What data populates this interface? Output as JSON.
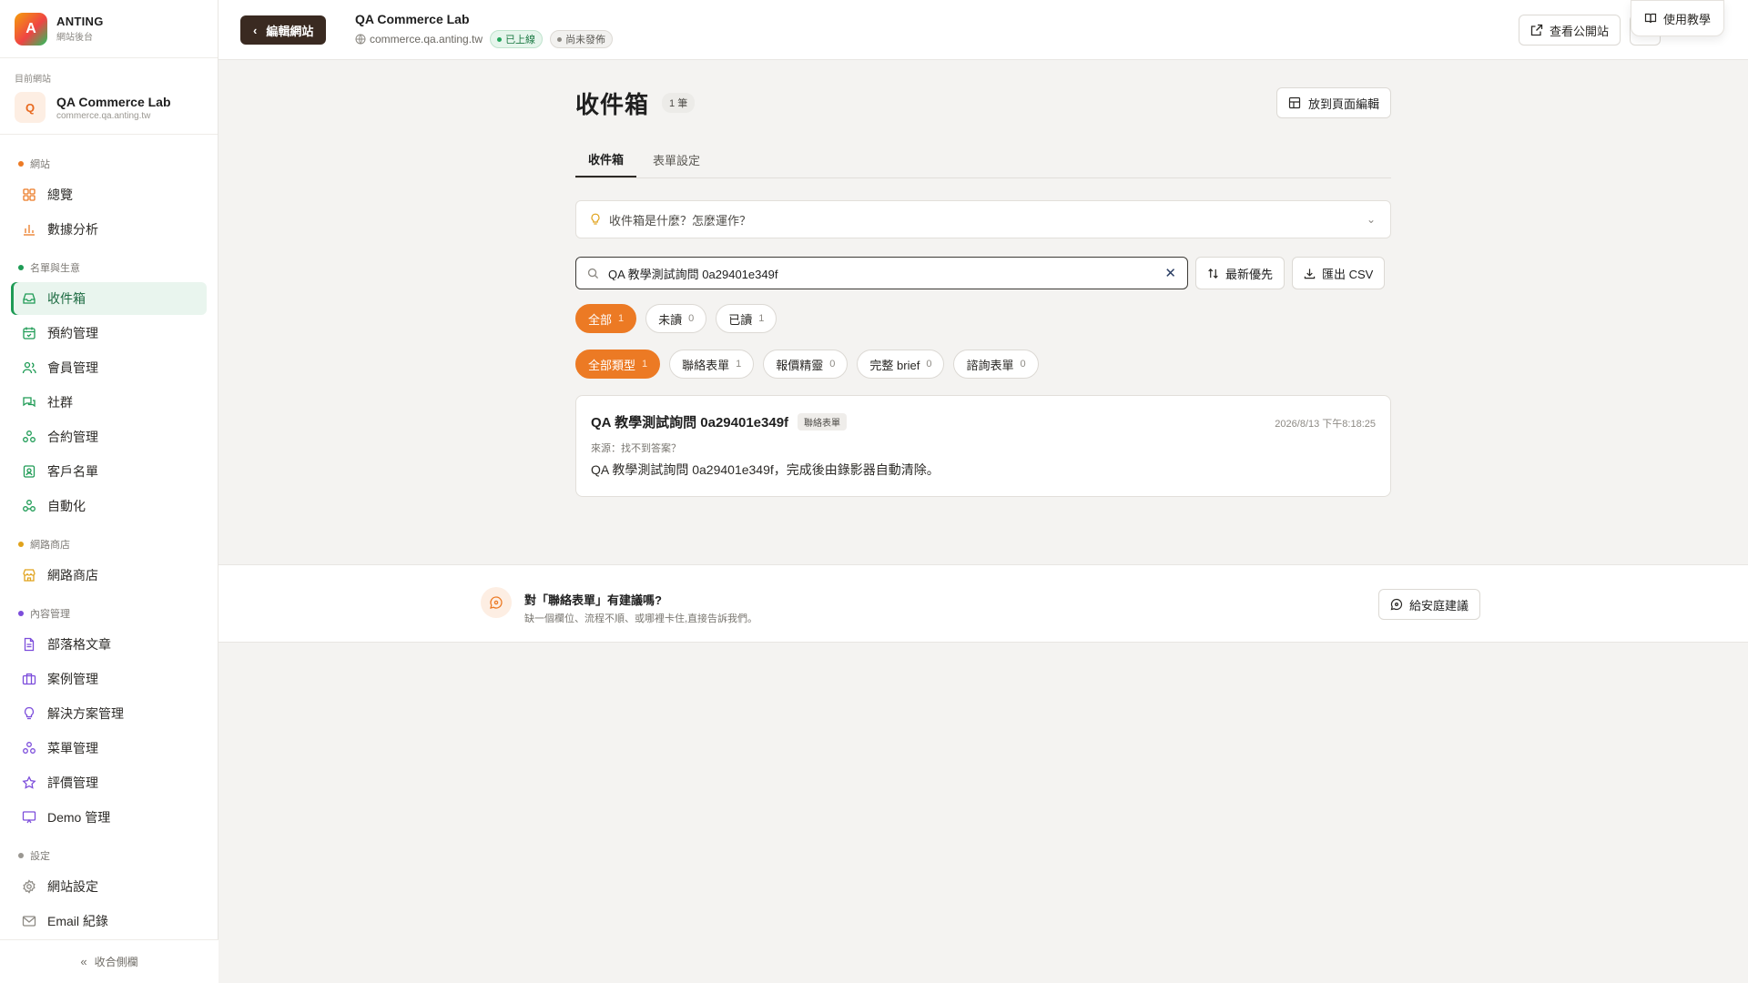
{
  "brand": {
    "logo_letter": "A",
    "name": "ANTING",
    "sub": "網站後台"
  },
  "current_site": {
    "label": "目前網站",
    "avatar": "Q",
    "name": "QA Commerce Lab",
    "domain": "commerce.qa.anting.tw"
  },
  "nav": {
    "groups": [
      {
        "label": "網站",
        "color": "#ec7a24",
        "items": [
          {
            "label": "總覽",
            "icon": "grid-icon"
          },
          {
            "label": "數據分析",
            "icon": "bar-chart-icon"
          }
        ]
      },
      {
        "label": "名單與生意",
        "color": "#1e9b55",
        "items": [
          {
            "label": "收件箱",
            "icon": "inbox-icon",
            "active": true
          },
          {
            "label": "預約管理",
            "icon": "calendar-icon"
          },
          {
            "label": "會員管理",
            "icon": "users-icon"
          },
          {
            "label": "社群",
            "icon": "chat-icon"
          },
          {
            "label": "合約管理",
            "icon": "nodes-icon"
          },
          {
            "label": "客戶名單",
            "icon": "contact-icon"
          },
          {
            "label": "自動化",
            "icon": "automation-icon"
          }
        ]
      },
      {
        "label": "網路商店",
        "color": "#e0a21b",
        "items": [
          {
            "label": "網路商店",
            "icon": "store-icon"
          }
        ]
      },
      {
        "label": "內容管理",
        "color": "#7c4ddb",
        "items": [
          {
            "label": "部落格文章",
            "icon": "document-icon"
          },
          {
            "label": "案例管理",
            "icon": "briefcase-icon"
          },
          {
            "label": "解決方案管理",
            "icon": "lightbulb-icon"
          },
          {
            "label": "菜單管理",
            "icon": "menu-nodes-icon"
          },
          {
            "label": "評價管理",
            "icon": "star-icon"
          },
          {
            "label": "Demo 管理",
            "icon": "presentation-icon"
          }
        ]
      },
      {
        "label": "設定",
        "color": "#9a9791",
        "items": [
          {
            "label": "網站設定",
            "icon": "gear-icon"
          },
          {
            "label": "Email 紀錄",
            "icon": "mail-icon"
          }
        ]
      }
    ],
    "collapse_label": "收合側欄"
  },
  "topbar": {
    "edit_label": "編輯網站",
    "site_title": "QA Commerce Lab",
    "site_domain": "commerce.qa.anting.tw",
    "status_live": "已上線",
    "status_draft": "尚未發佈",
    "view_site_label": "查看公開站",
    "tutorial_label": "使用教學"
  },
  "page": {
    "title": "收件箱",
    "count_badge": "1 筆",
    "place_button": "放到頁面編輯",
    "tabs": [
      {
        "label": "收件箱",
        "active": true
      },
      {
        "label": "表單設定",
        "active": false
      }
    ],
    "accordion_label": "收件箱是什麼？怎麼運作？",
    "search_value": "QA 教學測試詢問 0a29401e349f",
    "sort_label": "最新優先",
    "csv_label": "匯出 CSV",
    "status_chips": [
      {
        "label": "全部",
        "count": "1",
        "active": true
      },
      {
        "label": "未讀",
        "count": "0"
      },
      {
        "label": "已讀",
        "count": "1"
      }
    ],
    "type_chips": [
      {
        "label": "全部類型",
        "count": "1",
        "active": true
      },
      {
        "label": "聯絡表單",
        "count": "1"
      },
      {
        "label": "報價精靈",
        "count": "0"
      },
      {
        "label": "完整 brief",
        "count": "0"
      },
      {
        "label": "諮詢表單",
        "count": "0"
      }
    ],
    "message": {
      "title": "QA 教學測試詢問 0a29401e349f",
      "tag": "聯絡表單",
      "time": "2026/8/13 下午8:18:25",
      "source": "來源：找不到答案？",
      "body": "QA 教學測試詢問 0a29401e349f，完成後由錄影器自動清除。"
    }
  },
  "feedback": {
    "title": "對「聯絡表單」有建議嗎?",
    "sub": "缺一個欄位、流程不順、或哪裡卡住,直接告訴我們。",
    "button": "給安庭建議"
  },
  "colors": {
    "accent": "#ec7a24",
    "active_nav": "#1e9b55",
    "edit_button": "#3a2a21"
  }
}
